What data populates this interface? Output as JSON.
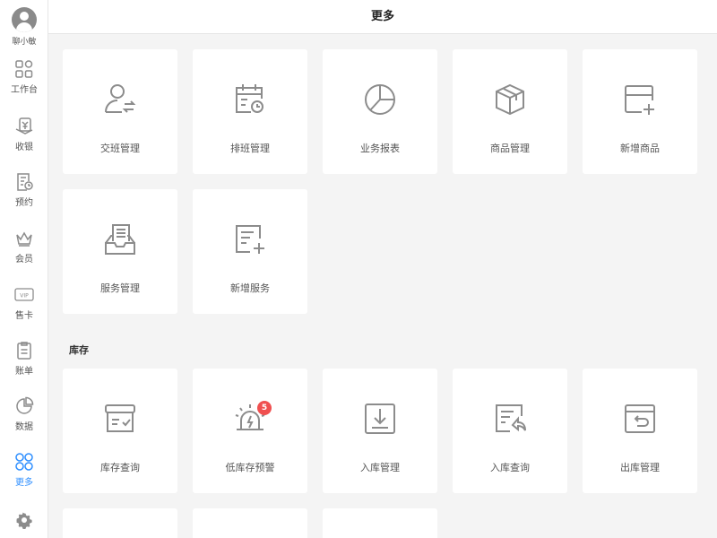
{
  "header": {
    "title": "更多"
  },
  "user": {
    "name": "聊小敏"
  },
  "nav": [
    {
      "label": "工作台",
      "icon": "grid-icon"
    },
    {
      "label": "收银",
      "icon": "cashier-icon"
    },
    {
      "label": "预约",
      "icon": "appointment-icon"
    },
    {
      "label": "会员",
      "icon": "crown-icon"
    },
    {
      "label": "售卡",
      "icon": "vip-card-icon"
    },
    {
      "label": "账单",
      "icon": "bill-icon"
    },
    {
      "label": "数据",
      "icon": "pie-chart-icon"
    },
    {
      "label": "更多",
      "icon": "more-icon",
      "active": true
    }
  ],
  "cards": [
    {
      "label": "交班管理",
      "icon": "shift-handover-icon"
    },
    {
      "label": "排班管理",
      "icon": "schedule-icon"
    },
    {
      "label": "业务报表",
      "icon": "report-pie-icon"
    },
    {
      "label": "商品管理",
      "icon": "box-icon"
    },
    {
      "label": "新增商品",
      "icon": "add-product-icon"
    },
    {
      "label": "服务管理",
      "icon": "service-tray-icon"
    },
    {
      "label": "新增服务",
      "icon": "add-service-icon"
    }
  ],
  "inventory": {
    "title": "库存",
    "cards": [
      {
        "label": "库存查询",
        "icon": "stock-query-icon"
      },
      {
        "label": "低库存预警",
        "icon": "alarm-icon",
        "badge": "5"
      },
      {
        "label": "入库管理",
        "icon": "stock-in-icon"
      },
      {
        "label": "入库查询",
        "icon": "stock-in-query-icon"
      },
      {
        "label": "出库管理",
        "icon": "stock-out-icon"
      }
    ]
  },
  "colors": {
    "accent": "#2f8fff",
    "icon": "#8c8c8c",
    "badge": "#f05050"
  }
}
